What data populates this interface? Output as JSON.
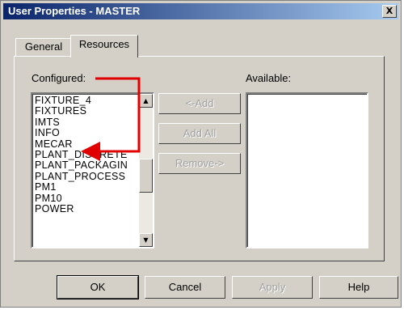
{
  "window": {
    "title": "User Properties - MASTER",
    "close_glyph": "X"
  },
  "tabs": [
    {
      "label": "General"
    },
    {
      "label": "Resources"
    }
  ],
  "configured": {
    "label": "Configured:",
    "items": [
      "FIXTURE_4",
      "FIXTURES",
      "IMTS",
      "INFO",
      "MECAR",
      "PLANT_DISCRETE",
      "PLANT_PACKAGIN",
      "PLANT_PROCESS",
      "PM1",
      "PM10",
      "POWER"
    ]
  },
  "available": {
    "label": "Available:",
    "items": []
  },
  "move_buttons": {
    "add": "<-Add",
    "add_all": "Add All",
    "remove": "Remove->"
  },
  "dialog_buttons": {
    "ok": "OK",
    "cancel": "Cancel",
    "apply": "Apply",
    "help": "Help"
  },
  "annotation": {
    "arrow_color": "#e00000"
  }
}
